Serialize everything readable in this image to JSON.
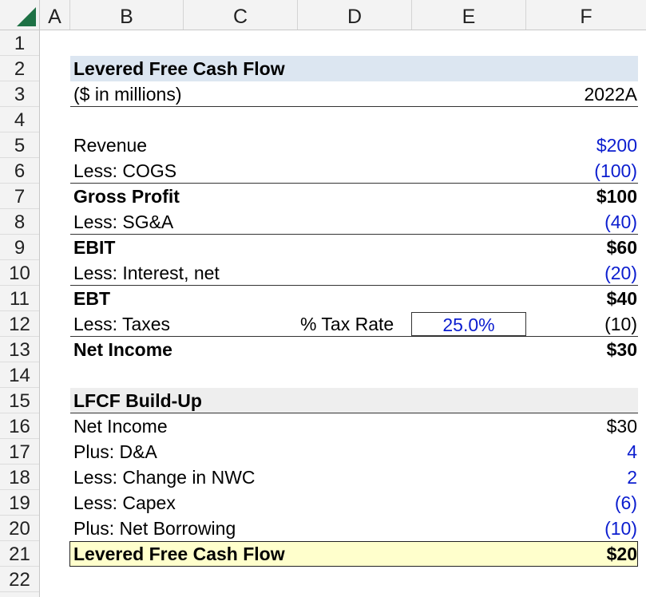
{
  "columns": [
    "A",
    "B",
    "C",
    "D",
    "E",
    "F"
  ],
  "rows": [
    "1",
    "2",
    "3",
    "4",
    "5",
    "6",
    "7",
    "8",
    "9",
    "10",
    "11",
    "12",
    "13",
    "14",
    "15",
    "16",
    "17",
    "18",
    "19",
    "20",
    "21",
    "22"
  ],
  "colors": {
    "input_blue": "#0b1dcf",
    "header_band": "#dce6f1",
    "section_band": "#eeeeee",
    "final_highlight": "#ffffcc",
    "excel_green": "#1e7145"
  },
  "lfcf": {
    "title": "Levered Free Cash Flow",
    "units": "($ in millions)",
    "year": "2022A",
    "revenue": {
      "label": "Revenue",
      "value": "$200"
    },
    "cogs": {
      "label": "Less: COGS",
      "value": "(100)"
    },
    "gross_profit": {
      "label": "Gross Profit",
      "value": "$100"
    },
    "sga": {
      "label": "Less: SG&A",
      "value": "(40)"
    },
    "ebit": {
      "label": "EBIT",
      "value": "$60"
    },
    "interest": {
      "label": "Less: Interest, net",
      "value": "(20)"
    },
    "ebt": {
      "label": "EBT",
      "value": "$40"
    },
    "taxes": {
      "label": "Less: Taxes",
      "rate_label": "% Tax Rate",
      "rate": "25.0%",
      "value": "(10)"
    },
    "net_income": {
      "label": "Net Income",
      "value": "$30"
    }
  },
  "buildup": {
    "title": "LFCF Build-Up",
    "net_income": {
      "label": "Net Income",
      "value": "$30"
    },
    "da": {
      "label": "Plus: D&A",
      "value": "4"
    },
    "nwc": {
      "label": "Less: Change in NWC",
      "value": "2"
    },
    "capex": {
      "label": "Less: Capex",
      "value": "(6)"
    },
    "borrowing": {
      "label": "Plus: Net Borrowing",
      "value": "(10)"
    },
    "lfcf": {
      "label": "Levered Free Cash Flow",
      "value": "$20"
    }
  }
}
